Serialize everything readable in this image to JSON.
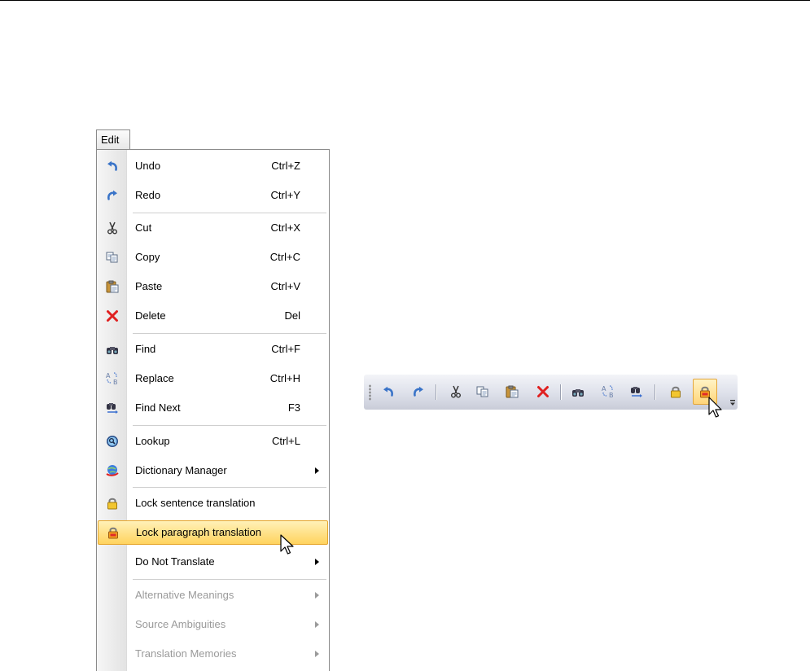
{
  "menu": {
    "title": "Edit",
    "items": [
      {
        "label": "Undo",
        "shortcut": "Ctrl+Z",
        "icon": "undo-icon"
      },
      {
        "label": "Redo",
        "shortcut": "Ctrl+Y",
        "icon": "redo-icon"
      },
      {
        "label": "Cut",
        "shortcut": "Ctrl+X",
        "icon": "cut-icon"
      },
      {
        "label": "Copy",
        "shortcut": "Ctrl+C",
        "icon": "copy-icon"
      },
      {
        "label": "Paste",
        "shortcut": "Ctrl+V",
        "icon": "paste-icon"
      },
      {
        "label": "Delete",
        "shortcut": "Del",
        "icon": "delete-icon"
      },
      {
        "label": "Find",
        "shortcut": "Ctrl+F",
        "icon": "find-icon"
      },
      {
        "label": "Replace",
        "shortcut": "Ctrl+H",
        "icon": "replace-icon"
      },
      {
        "label": "Find Next",
        "shortcut": "F3",
        "icon": "find-next-icon"
      },
      {
        "label": "Lookup",
        "shortcut": "Ctrl+L",
        "icon": "lookup-icon"
      },
      {
        "label": "Dictionary Manager",
        "submenu": true,
        "icon": "dictionary-manager-icon"
      },
      {
        "label": "Lock sentence translation",
        "icon": "lock-yellow-icon"
      },
      {
        "label": "Lock paragraph translation",
        "icon": "lock-red-icon",
        "highlighted": true
      },
      {
        "label": "Do Not Translate",
        "submenu": true
      },
      {
        "label": "Alternative Meanings",
        "submenu": true,
        "disabled": true
      },
      {
        "label": "Source Ambiguities",
        "submenu": true,
        "disabled": true
      },
      {
        "label": "Translation Memories",
        "submenu": true,
        "disabled": true
      }
    ]
  },
  "toolbar": {
    "buttons": [
      "undo-icon",
      "redo-icon",
      "cut-icon",
      "copy-icon",
      "paste-icon",
      "delete-icon",
      "find-icon",
      "replace-icon",
      "find-next-icon",
      "lock-yellow-icon",
      "lock-red-icon"
    ],
    "active_button": "lock-red-icon"
  },
  "colors": {
    "highlight": "#ffd35e",
    "highlight_border": "#e5a52c",
    "disabled_text": "#9a9a9a",
    "gutter": "#e3e3e3",
    "toolbar": "#dde0ea"
  }
}
